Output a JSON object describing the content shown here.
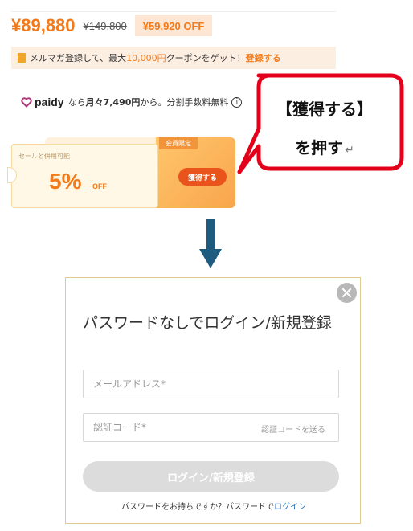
{
  "price": {
    "current": "¥89,880",
    "original": "¥149,800",
    "discount_badge": "¥59,920 OFF"
  },
  "newsletter_banner": {
    "icon": "mail-icon",
    "text_before": "メルマガ登録して、最大",
    "highlight": "10,000円",
    "text_after": "クーポンをゲット！",
    "link": "登録する"
  },
  "paidy": {
    "logo_text": "paidy",
    "prefix": "なら",
    "amount": "月々7,490円",
    "suffix": "から。分割手数料無料",
    "info_icon": "i"
  },
  "coupon": {
    "caption": "セールと併用可能",
    "percent": "5%",
    "off_label": "OFF",
    "member_tag": "会員限定",
    "claim_button": "獲得する",
    "colors": {
      "accent": "#f27a1a",
      "button": "#e8541c"
    }
  },
  "callout": {
    "line1": "【獲得する】",
    "line2": "を押す",
    "return_mark": "↵",
    "border_color": "#e3001b"
  },
  "arrow": {
    "icon": "down-arrow-icon",
    "color": "#1e5b7e"
  },
  "modal": {
    "close_icon": "close-icon",
    "title": "パスワードなしでログイン/新規登録",
    "email_placeholder": "メールアドレス*",
    "code_placeholder": "認証コード*",
    "send_code": "認証コードを送る",
    "login_button": "ログイン/新規登録",
    "footer_text": "パスワードをお持ちですか？パスワードで",
    "footer_link": "ログイン"
  }
}
